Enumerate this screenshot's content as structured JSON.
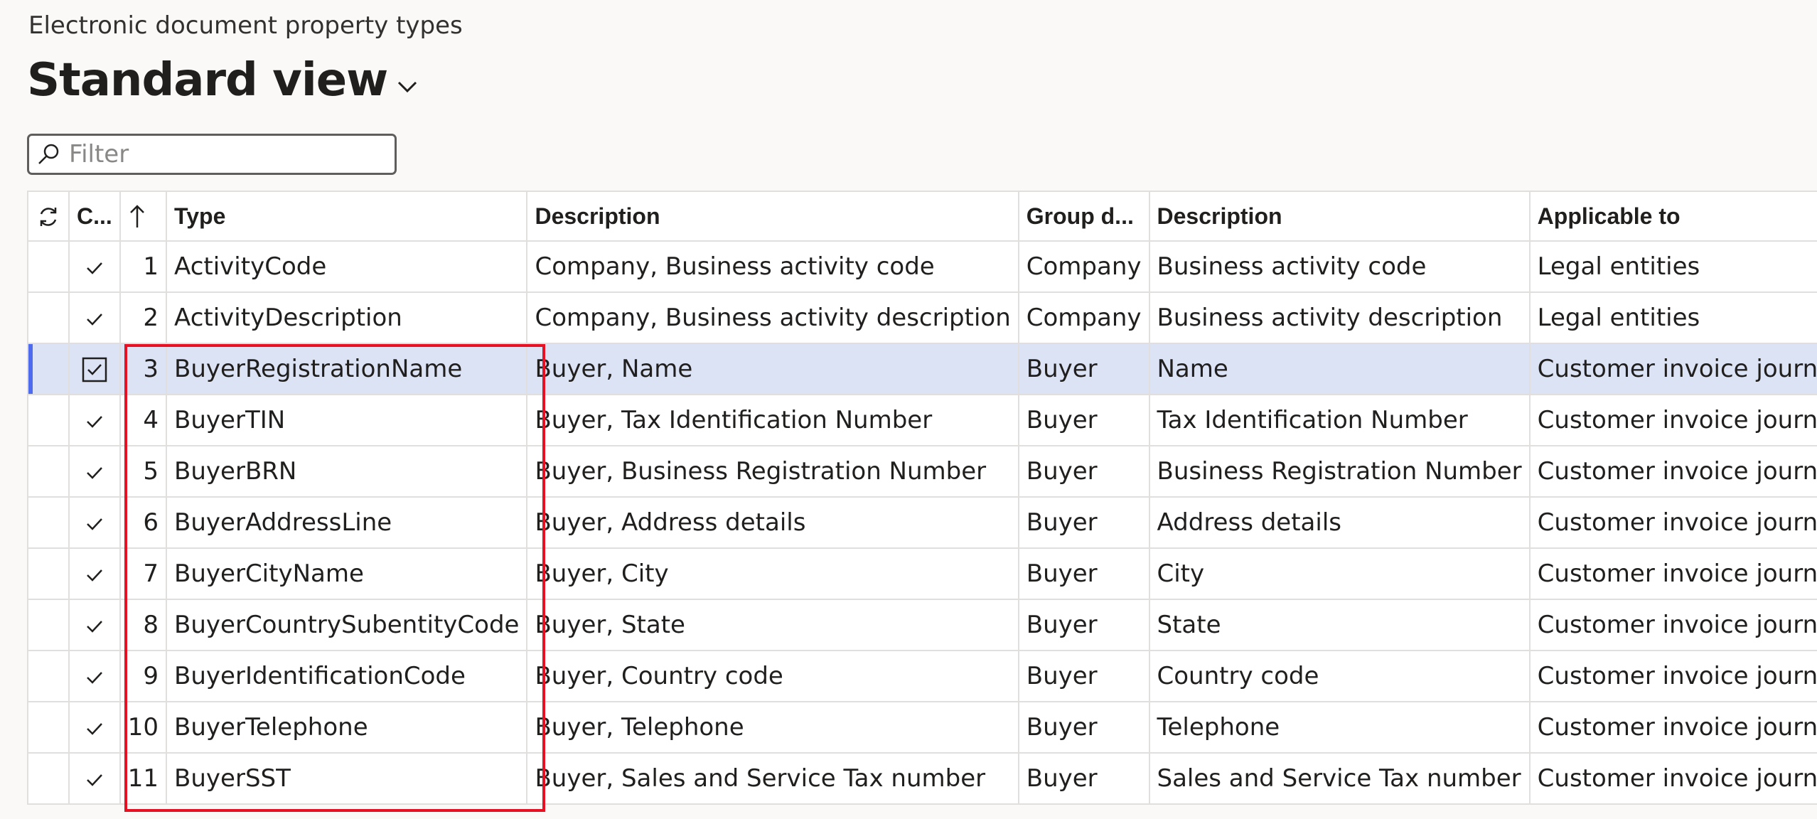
{
  "header": {
    "caption": "Electronic document property types",
    "view_title": "Standard view"
  },
  "filter": {
    "placeholder": "Filter",
    "value": ""
  },
  "grid": {
    "columns": {
      "refresh_icon": "refresh-icon",
      "check": "C...",
      "sort_icon": "sort-ascending-arrow",
      "type": "Type",
      "description": "Description",
      "group": "Group d...",
      "group_description": "Description",
      "applicable_to": "Applicable to"
    },
    "rows": [
      {
        "num": "1",
        "type": "ActivityCode",
        "description": "Company, Business activity code",
        "group": "Company",
        "group_description": "Business activity code",
        "applicable_to": "Legal entities"
      },
      {
        "num": "2",
        "type": "ActivityDescription",
        "description": "Company, Business activity description",
        "group": "Company",
        "group_description": "Business activity description",
        "applicable_to": "Legal entities"
      },
      {
        "num": "3",
        "type": "BuyerRegistrationName",
        "description": "Buyer, Name",
        "group": "Buyer",
        "group_description": "Name",
        "applicable_to": "Customer invoice journal"
      },
      {
        "num": "4",
        "type": "BuyerTIN",
        "description": "Buyer, Tax Identification Number",
        "group": "Buyer",
        "group_description": "Tax Identification Number",
        "applicable_to": "Customer invoice journal"
      },
      {
        "num": "5",
        "type": "BuyerBRN",
        "description": "Buyer, Business Registration Number",
        "group": "Buyer",
        "group_description": "Business Registration Number",
        "applicable_to": "Customer invoice journal"
      },
      {
        "num": "6",
        "type": "BuyerAddressLine",
        "description": "Buyer, Address details",
        "group": "Buyer",
        "group_description": "Address details",
        "applicable_to": "Customer invoice journal"
      },
      {
        "num": "7",
        "type": "BuyerCityName",
        "description": "Buyer, City",
        "group": "Buyer",
        "group_description": "City",
        "applicable_to": "Customer invoice journal"
      },
      {
        "num": "8",
        "type": "BuyerCountrySubentityCode",
        "description": "Buyer, State",
        "group": "Buyer",
        "group_description": "State",
        "applicable_to": "Customer invoice journal"
      },
      {
        "num": "9",
        "type": "BuyerIdentificationCode",
        "description": "Buyer, Country code",
        "group": "Buyer",
        "group_description": "Country code",
        "applicable_to": "Customer invoice journal"
      },
      {
        "num": "10",
        "type": "BuyerTelephone",
        "description": "Buyer, Telephone",
        "group": "Buyer",
        "group_description": "Telephone",
        "applicable_to": "Customer invoice journal"
      },
      {
        "num": "11",
        "type": "BuyerSST",
        "description": "Buyer, Sales and Service Tax number",
        "group": "Buyer",
        "group_description": "Sales and Service Tax number",
        "applicable_to": "Customer invoice journal"
      }
    ],
    "selected_row": "3"
  },
  "colors": {
    "selection": "#dce3f5",
    "selection_bar": "#4f6bed",
    "highlight_box": "#e81123"
  }
}
